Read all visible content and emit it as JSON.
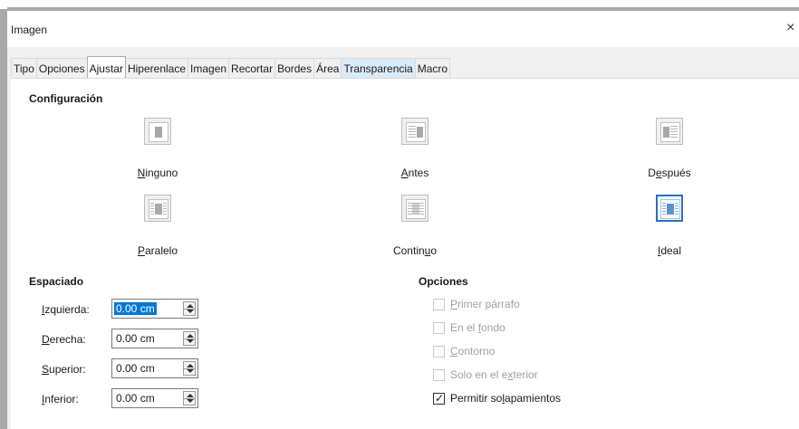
{
  "window": {
    "title": "Imagen",
    "close_glyph": "×"
  },
  "tabs": [
    {
      "label": "Tipo",
      "active": false
    },
    {
      "label": "Opciones",
      "active": false
    },
    {
      "label": "Ajustar",
      "active": true
    },
    {
      "label": "Hiperenlace",
      "active": false
    },
    {
      "label": "Imagen",
      "active": false
    },
    {
      "label": "Recortar",
      "active": false
    },
    {
      "label": "Bordes",
      "active": false
    },
    {
      "label": "Área",
      "active": false
    },
    {
      "label": "Transparencia",
      "active": false,
      "hover": true
    },
    {
      "label": "Macro",
      "active": false
    }
  ],
  "config": {
    "title": "Configuración",
    "wrap": {
      "none": {
        "pre": "",
        "ul": "N",
        "post": "inguno",
        "icon": "wrap-none-icon"
      },
      "before": {
        "pre": "",
        "ul": "A",
        "post": "ntes",
        "icon": "wrap-before-icon"
      },
      "after": {
        "pre": "D",
        "ul": "e",
        "post": "spués",
        "icon": "wrap-after-icon"
      },
      "parallel": {
        "pre": "",
        "ul": "P",
        "post": "aralelo",
        "icon": "wrap-parallel-icon"
      },
      "through": {
        "pre": "Contin",
        "ul": "u",
        "post": "o",
        "icon": "wrap-through-icon"
      },
      "optimal": {
        "pre": "",
        "ul": "I",
        "post": "deal",
        "icon": "wrap-optimal-icon",
        "selected": true
      }
    }
  },
  "spacing": {
    "title": "Espaciado",
    "left": {
      "ul": "I",
      "post": "zquierda:",
      "value": "0.00 cm"
    },
    "right": {
      "ul": "D",
      "post": "erecha:",
      "value": "0.00 cm"
    },
    "top": {
      "ul": "S",
      "post": "uperior:",
      "value": "0.00 cm"
    },
    "bottom": {
      "ul": "I",
      "post": "nferior:",
      "value": "0.00 cm"
    }
  },
  "options": {
    "title": "Opciones",
    "first_paragraph": {
      "pre": "",
      "ul": "P",
      "post": "rimer párrafo",
      "checked": false,
      "enabled": false
    },
    "background": {
      "pre": "En el ",
      "ul": "f",
      "post": "ondo",
      "checked": false,
      "enabled": false
    },
    "contour": {
      "pre": "",
      "ul": "C",
      "post": "ontorno",
      "checked": false,
      "enabled": false
    },
    "outside_only": {
      "pre": "Solo en el e",
      "ul": "x",
      "post": "terior",
      "checked": false,
      "enabled": false
    },
    "allow_overlap": {
      "pre": "Permitir so",
      "ul": "l",
      "post": "apamientos",
      "checked": true,
      "enabled": true,
      "check_glyph": "✓"
    }
  }
}
